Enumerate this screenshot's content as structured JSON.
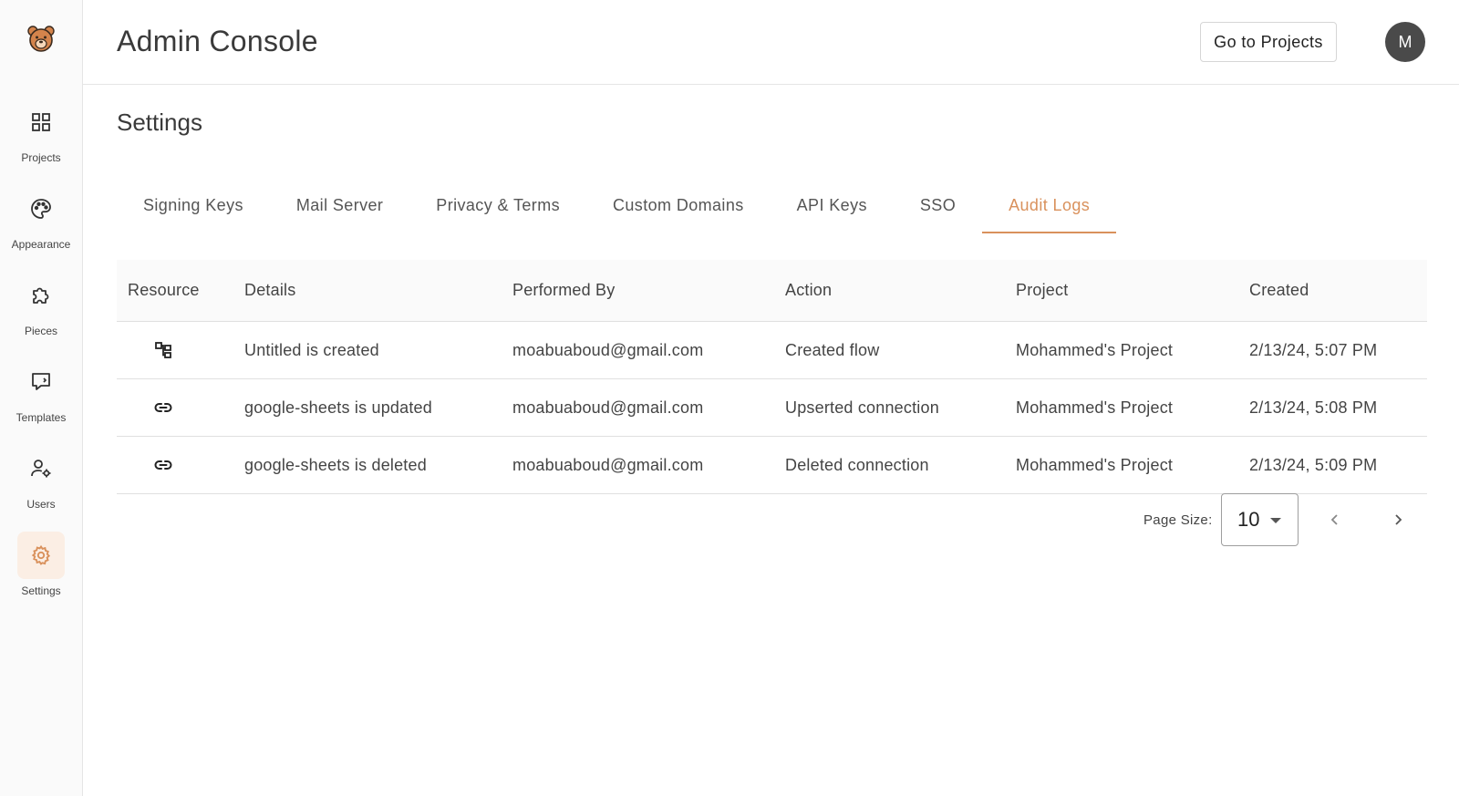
{
  "app": {
    "title": "Admin Console"
  },
  "header": {
    "goto_label": "Go to Projects",
    "avatar_initial": "M"
  },
  "sidebar": {
    "items": [
      {
        "label": "Projects",
        "icon": "grid-icon"
      },
      {
        "label": "Appearance",
        "icon": "palette-icon"
      },
      {
        "label": "Pieces",
        "icon": "puzzle-icon"
      },
      {
        "label": "Templates",
        "icon": "template-icon"
      },
      {
        "label": "Users",
        "icon": "user-gear-icon"
      },
      {
        "label": "Settings",
        "icon": "gear-icon",
        "active": true
      }
    ]
  },
  "main": {
    "section_title": "Settings",
    "tabs": [
      {
        "label": "Signing Keys"
      },
      {
        "label": "Mail Server"
      },
      {
        "label": "Privacy & Terms"
      },
      {
        "label": "Custom Domains"
      },
      {
        "label": "API Keys"
      },
      {
        "label": "SSO"
      },
      {
        "label": "Audit Logs",
        "active": true
      }
    ],
    "table": {
      "headers": [
        "Resource",
        "Details",
        "Performed By",
        "Action",
        "Project",
        "Created"
      ],
      "rows": [
        {
          "resource_icon": "flow-icon",
          "details": "Untitled is created",
          "performed_by": "moabuaboud@gmail.com",
          "action": "Created flow",
          "project": "Mohammed's Project",
          "created": "2/13/24, 5:07 PM"
        },
        {
          "resource_icon": "link-icon",
          "details": "google-sheets is updated",
          "performed_by": "moabuaboud@gmail.com",
          "action": "Upserted connection",
          "project": "Mohammed's Project",
          "created": "2/13/24, 5:08 PM"
        },
        {
          "resource_icon": "link-icon",
          "details": "google-sheets is deleted",
          "performed_by": "moabuaboud@gmail.com",
          "action": "Deleted connection",
          "project": "Mohammed's Project",
          "created": "2/13/24, 5:09 PM"
        }
      ]
    },
    "pagination": {
      "label": "Page Size:",
      "page_size": "10"
    }
  },
  "colors": {
    "accent": "#d9915c",
    "active_bg": "#fbeee4",
    "avatar_bg": "#4a4a4a"
  }
}
